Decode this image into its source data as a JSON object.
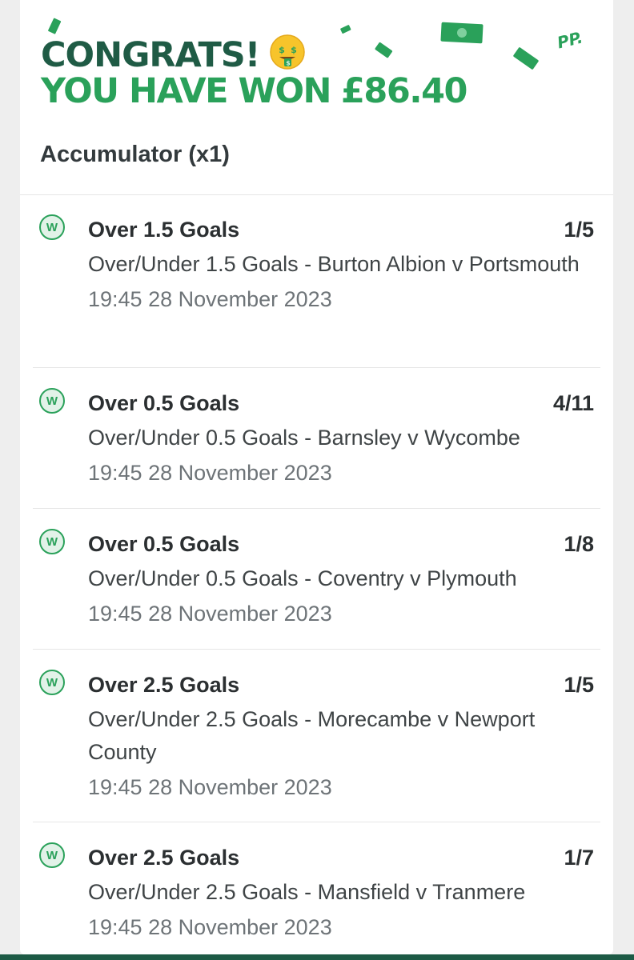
{
  "header": {
    "congrats": "CONGRATS!",
    "won_prefix": "YOU HAVE WON",
    "won_amount": "£86.40",
    "bet_type": "Accumulator (x1)",
    "corner_text": "PP.",
    "emoji_icon": "money-mouth-face-icon"
  },
  "colors": {
    "dark_green": "#1f5b45",
    "bright_green": "#2aa15a",
    "badge_bg": "#e2f2e8"
  },
  "legs": [
    {
      "badge": "W",
      "selection": "Over 1.5 Goals",
      "odds": "1/5",
      "market": "Over/Under 1.5 Goals - Burton Albion v Portsmouth",
      "time": "19:45 28 November 2023"
    },
    {
      "badge": "W",
      "selection": "Over 0.5 Goals",
      "odds": "4/11",
      "market": "Over/Under 0.5 Goals - Barnsley v Wycombe",
      "time": "19:45 28 November 2023"
    },
    {
      "badge": "W",
      "selection": "Over 0.5 Goals",
      "odds": "1/8",
      "market": "Over/Under 0.5 Goals - Coventry v Plymouth",
      "time": "19:45 28 November 2023"
    },
    {
      "badge": "W",
      "selection": "Over 2.5 Goals",
      "odds": "1/5",
      "market": "Over/Under 2.5 Goals - Morecambe v Newport County",
      "time": "19:45 28 November 2023"
    },
    {
      "badge": "W",
      "selection": "Over 2.5 Goals",
      "odds": "1/7",
      "market": "Over/Under 2.5 Goals - Mansfield v Tranmere",
      "time": "19:45 28 November 2023"
    }
  ]
}
